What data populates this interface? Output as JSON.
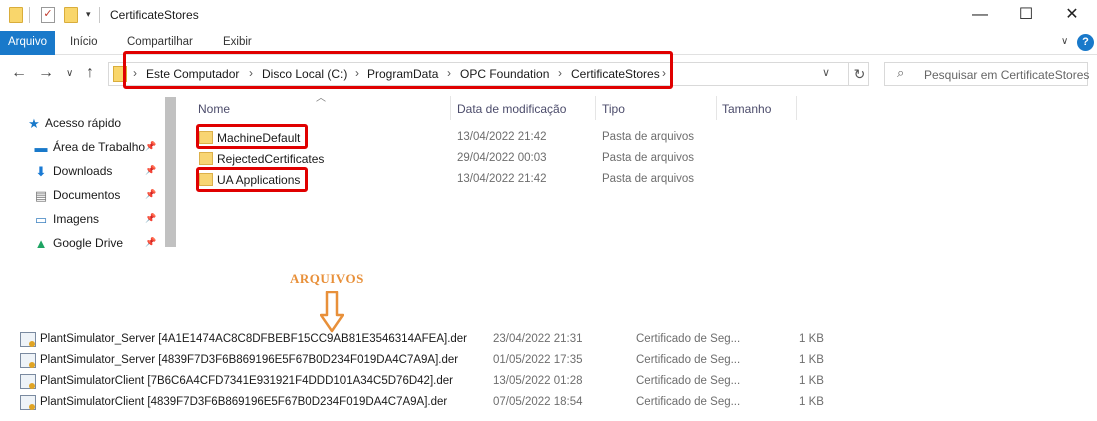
{
  "window": {
    "title": "CertificateStores",
    "minimize_glyph": "—",
    "maximize_glyph": "☐",
    "close_glyph": "✕"
  },
  "ribbon": {
    "tabs": [
      {
        "label": "Arquivo",
        "active": true
      },
      {
        "label": "Início"
      },
      {
        "label": "Compartilhar"
      },
      {
        "label": "Exibir"
      }
    ],
    "help": "?"
  },
  "address_bar": {
    "breadcrumbs": [
      "Este Computador",
      "Disco Local (C:)",
      "ProgramData",
      "OPC Foundation",
      "CertificateStores"
    ]
  },
  "search": {
    "placeholder": "Pesquisar em CertificateStores"
  },
  "nav_pane": {
    "items": [
      {
        "label": "Acesso rápido",
        "icon": "star-icon"
      },
      {
        "label": "Área de Trabalho",
        "icon": "desktop-icon",
        "pinned": true
      },
      {
        "label": "Downloads",
        "icon": "download-arrow-icon",
        "pinned": true
      },
      {
        "label": "Documentos",
        "icon": "documents-icon",
        "pinned": true
      },
      {
        "label": "Imagens",
        "icon": "pictures-icon",
        "pinned": true
      },
      {
        "label": "Google Drive",
        "icon": "google-drive-icon",
        "pinned": true
      }
    ]
  },
  "columns": {
    "name": "Nome",
    "date": "Data de modificação",
    "type": "Tipo",
    "size": "Tamanho"
  },
  "folders": [
    {
      "name": "MachineDefault",
      "date": "13/04/2022 21:42",
      "type": "Pasta de arquivos",
      "highlighted": true
    },
    {
      "name": "RejectedCertificates",
      "date": "29/04/2022 00:03",
      "type": "Pasta de arquivos"
    },
    {
      "name": "UA Applications",
      "date": "13/04/2022 21:42",
      "type": "Pasta de arquivos",
      "highlighted": true
    }
  ],
  "annotation": {
    "label": "ARQUIVOS",
    "color": "#e8903a"
  },
  "files": [
    {
      "name": "PlantSimulator_Server [4A1E1474AC8C8DFBEBF15CC9AB81E3546314AFEA].der",
      "date": "23/04/2022 21:31",
      "type": "Certificado de Seg...",
      "size": "1 KB"
    },
    {
      "name": "PlantSimulator_Server [4839F7D3F6B869196E5F67B0D234F019DA4C7A9A].der",
      "date": "01/05/2022 17:35",
      "type": "Certificado de Seg...",
      "size": "1 KB"
    },
    {
      "name": "PlantSimulatorClient [7B6C6A4CFD7341E931921F4DDD101A34C5D76D42].der",
      "date": "13/05/2022 01:28",
      "type": "Certificado de Seg...",
      "size": "1 KB"
    },
    {
      "name": "PlantSimulatorClient [4839F7D3F6B869196E5F67B0D234F019DA4C7A9A].der",
      "date": "07/05/2022 18:54",
      "type": "Certificado de Seg...",
      "size": "1 KB"
    }
  ],
  "colors": {
    "accent": "#1979ca",
    "highlight_box": "#e00000"
  }
}
